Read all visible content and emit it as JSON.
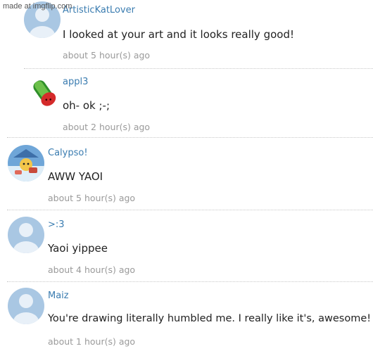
{
  "watermark": "made at imgflip.com",
  "comments": [
    {
      "username": "ArtisticKatLover",
      "text": "I looked at your art and it looks really good!",
      "time": "about 5 hour(s) ago",
      "avatar": "default-avatar-icon"
    },
    {
      "username": "appl3",
      "text": "oh- ok ;-;",
      "time": "about 2 hour(s) ago",
      "avatar": "watermelon-avatar-icon"
    },
    {
      "username": "Calypso!",
      "text": "AWW YAOI",
      "time": "about 5 hour(s) ago",
      "avatar": "anime-character-avatar-icon"
    },
    {
      "username": ">:3",
      "text": "Yaoi yippee",
      "time": "about 4 hour(s) ago",
      "avatar": "default-avatar-icon"
    },
    {
      "username": "Maiz",
      "text": "You're drawing literally humbled me. I really like it's, awesome!",
      "time": "about 1 hour(s) ago",
      "avatar": "default-avatar-icon"
    }
  ],
  "colors": {
    "username": "#3a7cb0",
    "text": "#222222",
    "time": "#9a9a9a",
    "divider": "#c8c8c8",
    "avatar_default": "#a9c7e3"
  }
}
